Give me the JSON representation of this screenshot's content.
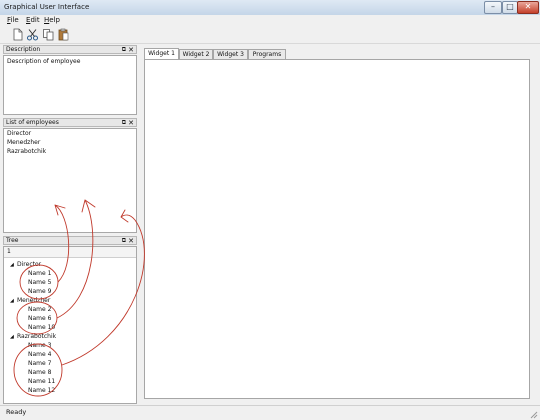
{
  "window": {
    "title": "Graphical User Interface"
  },
  "menu": {
    "items": [
      {
        "label": "File",
        "underline": "F"
      },
      {
        "label": "Edit",
        "underline": "E"
      },
      {
        "label": "Help",
        "underline": "H"
      }
    ]
  },
  "toolbar": {
    "icons": [
      "new-document-icon",
      "cut-icon",
      "copy-icon",
      "paste-icon"
    ]
  },
  "docks": {
    "description": {
      "title": "Description",
      "text": "Description of employee"
    },
    "employees": {
      "title": "List of employees",
      "items": [
        "Director",
        "Menedzher",
        "Razrabotchik"
      ]
    },
    "tree": {
      "title": "Tree",
      "header": "1",
      "groups": [
        {
          "label": "Director",
          "children": [
            "Name 1",
            "Name 5",
            "Name 9"
          ]
        },
        {
          "label": "Menedzher",
          "children": [
            "Name 2",
            "Name 6",
            "Name 10"
          ]
        },
        {
          "label": "Razrabotchik",
          "children": [
            "Name 3",
            "Name 4",
            "Name 7",
            "Name 8",
            "Name 11",
            "Name 12"
          ]
        }
      ]
    }
  },
  "tabs": [
    {
      "label": "Widget 1",
      "active": true
    },
    {
      "label": "Widget 2",
      "active": false
    },
    {
      "label": "Widget 3",
      "active": false
    },
    {
      "label": "Programs",
      "active": false
    }
  ],
  "status": {
    "text": "Ready"
  },
  "colors": {
    "annotation": "#c0392b",
    "close_button": "#c5402a"
  }
}
